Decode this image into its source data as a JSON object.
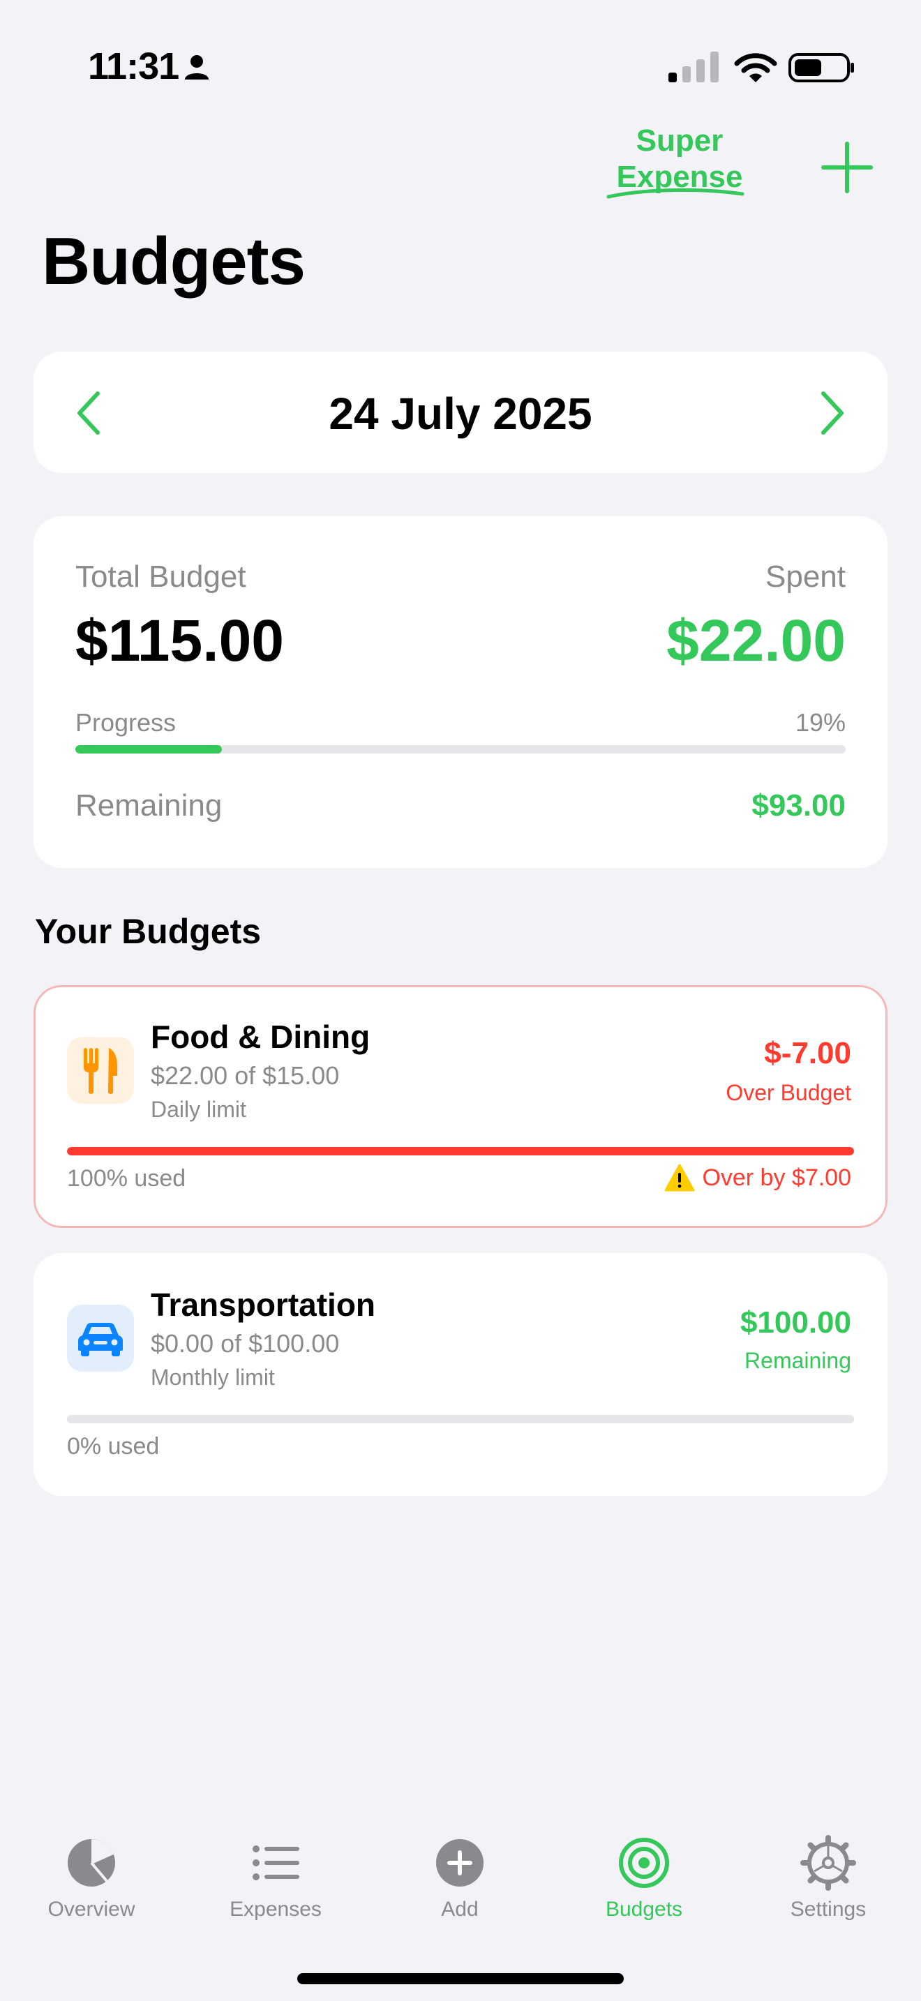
{
  "status_bar": {
    "time": "11:31",
    "icons": [
      "person-icon",
      "signal-icon",
      "wifi-icon",
      "battery-icon"
    ]
  },
  "header": {
    "brand_line1": "Super",
    "brand_line2": "Expense",
    "add_icon": "plus-icon",
    "title": "Budgets"
  },
  "date_nav": {
    "date": "24 July 2025",
    "prev_icon": "chevron-left-icon",
    "next_icon": "chevron-right-icon"
  },
  "summary": {
    "total_label": "Total Budget",
    "total_amount": "$115.00",
    "spent_label": "Spent",
    "spent_amount": "$22.00",
    "progress_label": "Progress",
    "progress_percent": "19%",
    "progress_value": 0.19,
    "remaining_label": "Remaining",
    "remaining_amount": "$93.00"
  },
  "section_title": "Your Budgets",
  "budgets": [
    {
      "name": "Food & Dining",
      "icon": "fork-knife-icon",
      "subtitle": "$22.00 of $15.00",
      "limit": "Daily limit",
      "amount": "$-7.00",
      "status": "Over Budget",
      "used": "100% used",
      "used_value": 1.0,
      "warning": "Over by $7.00"
    },
    {
      "name": "Transportation",
      "icon": "car-icon",
      "subtitle": "$0.00 of $100.00",
      "limit": "Monthly limit",
      "amount": "$100.00",
      "status": "Remaining",
      "used": "0% used",
      "used_value": 0.0
    }
  ],
  "tab_bar": {
    "active": "Budgets",
    "tabs": [
      {
        "label": "Overview",
        "icon": "pie-chart-icon"
      },
      {
        "label": "Expenses",
        "icon": "list-icon"
      },
      {
        "label": "Add",
        "icon": "plus-circle-icon"
      },
      {
        "label": "Budgets",
        "icon": "target-icon"
      },
      {
        "label": "Settings",
        "icon": "gear-icon"
      }
    ]
  },
  "colors": {
    "accent": "#34C759",
    "danger": "#FF3B30",
    "background": "#F2F2F7",
    "food_icon": "#FF9500",
    "transport_icon": "#0A84FF",
    "warning": "#FFCC00"
  }
}
